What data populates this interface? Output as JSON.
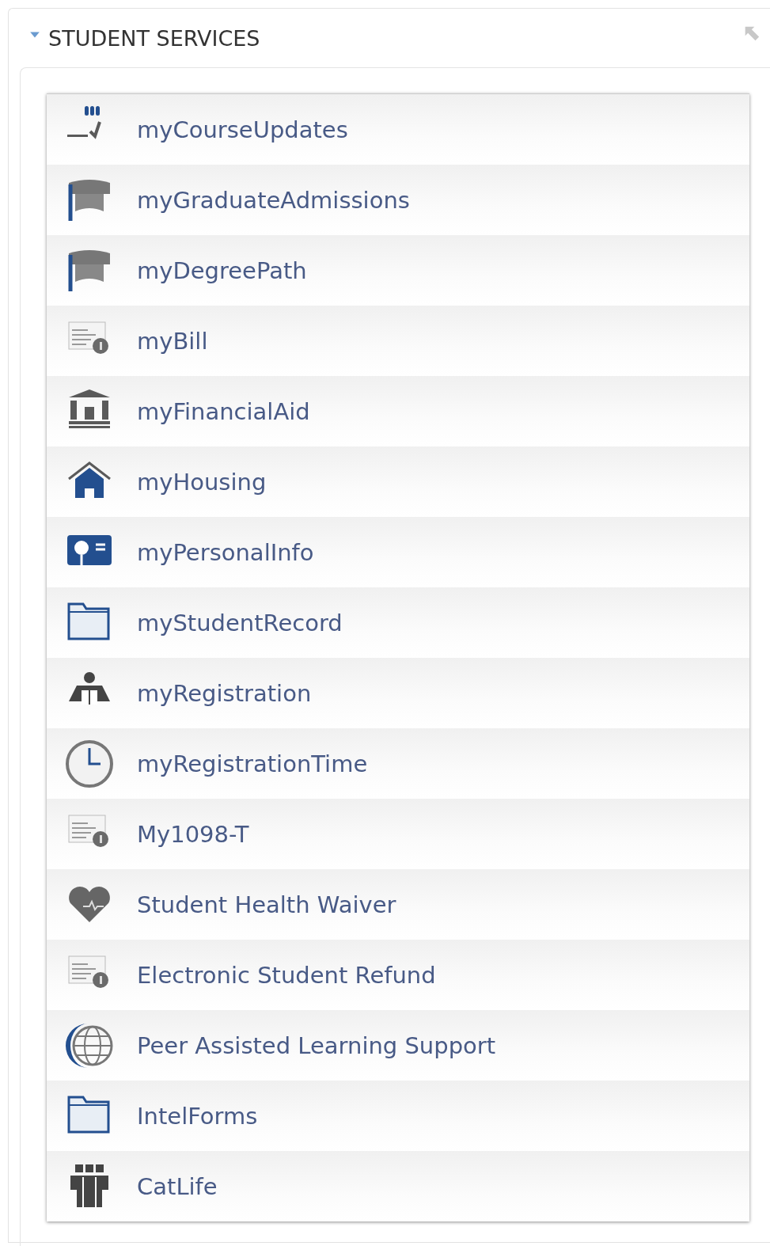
{
  "portlet": {
    "title": "STUDENT SERVICES",
    "expanded": true
  },
  "items": [
    {
      "label": "myCourseUpdates",
      "kind": "checklist"
    },
    {
      "label": "myGraduateAdmissions",
      "kind": "cap"
    },
    {
      "label": "myDegreePath",
      "kind": "cap"
    },
    {
      "label": "myBill",
      "kind": "bill"
    },
    {
      "label": "myFinancialAid",
      "kind": "bank"
    },
    {
      "label": "myHousing",
      "kind": "house"
    },
    {
      "label": "myPersonalInfo",
      "kind": "idcard"
    },
    {
      "label": "myStudentRecord",
      "kind": "folder"
    },
    {
      "label": "myRegistration",
      "kind": "reader"
    },
    {
      "label": "myRegistrationTime",
      "kind": "clock"
    },
    {
      "label": "My1098-T",
      "kind": "bill"
    },
    {
      "label": "Student Health Waiver",
      "kind": "heart"
    },
    {
      "label": "Electronic Student Refund",
      "kind": "bill"
    },
    {
      "label": "Peer Assisted Learning Support",
      "kind": "globe"
    },
    {
      "label": "IntelForms",
      "kind": "folder"
    },
    {
      "label": "CatLife",
      "kind": "group"
    }
  ]
}
